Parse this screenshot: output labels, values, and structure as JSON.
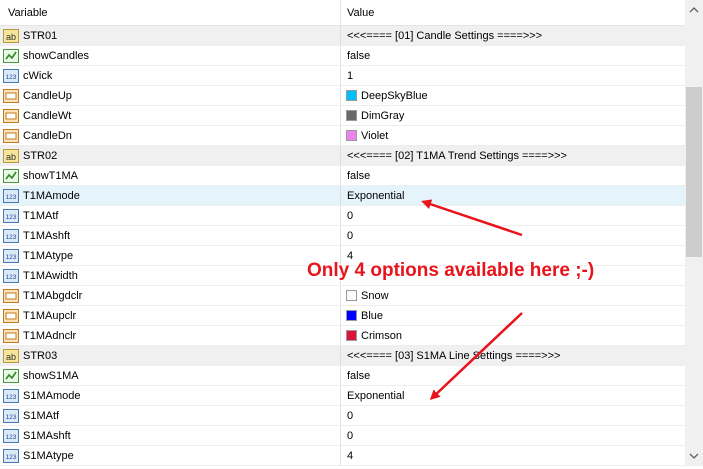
{
  "header": {
    "variable": "Variable",
    "value": "Value"
  },
  "rows": [
    {
      "icon": "ab",
      "name": "STR01",
      "value": "<<<==== [01] Candle Settings ====>>>",
      "type": "str"
    },
    {
      "icon": "bool",
      "name": "showCandles",
      "value": "false"
    },
    {
      "icon": "num",
      "name": "cWick",
      "value": "1"
    },
    {
      "icon": "color",
      "name": "CandleUp",
      "value": "DeepSkyBlue",
      "color": "#00bfff"
    },
    {
      "icon": "color",
      "name": "CandleWt",
      "value": "DimGray",
      "color": "#696969"
    },
    {
      "icon": "color",
      "name": "CandleDn",
      "value": "Violet",
      "color": "#ee82ee"
    },
    {
      "icon": "ab",
      "name": "STR02",
      "value": "<<<==== [02] T1MA Trend Settings ====>>>",
      "type": "str"
    },
    {
      "icon": "bool",
      "name": "showT1MA",
      "value": "false"
    },
    {
      "icon": "num",
      "name": "T1MAmode",
      "value": "Exponential",
      "type": "sel"
    },
    {
      "icon": "num",
      "name": "T1MAtf",
      "value": "0"
    },
    {
      "icon": "num",
      "name": "T1MAshft",
      "value": "0"
    },
    {
      "icon": "num",
      "name": "T1MAtype",
      "value": "4"
    },
    {
      "icon": "num",
      "name": "T1MAwidth",
      "value": ""
    },
    {
      "icon": "color",
      "name": "T1MAbgdclr",
      "value": "Snow",
      "color": "#fffafa"
    },
    {
      "icon": "color",
      "name": "T1MAupclr",
      "value": "Blue",
      "color": "#0000ff"
    },
    {
      "icon": "color",
      "name": "T1MAdnclr",
      "value": "Crimson",
      "color": "#dc143c"
    },
    {
      "icon": "ab",
      "name": "STR03",
      "value": "<<<==== [03] S1MA Line Settings ====>>>",
      "type": "str"
    },
    {
      "icon": "bool",
      "name": "showS1MA",
      "value": "false"
    },
    {
      "icon": "num",
      "name": "S1MAmode",
      "value": "Exponential"
    },
    {
      "icon": "num",
      "name": "S1MAtf",
      "value": "0"
    },
    {
      "icon": "num",
      "name": "S1MAshft",
      "value": "0"
    },
    {
      "icon": "num",
      "name": "S1MAtype",
      "value": "4"
    }
  ],
  "annotation": {
    "text": "Only 4 options available here ;-)",
    "color": "#e8141b"
  },
  "icons": {
    "ab": "string-icon",
    "bool": "bool-icon",
    "num": "number-icon",
    "color": "color-icon"
  }
}
